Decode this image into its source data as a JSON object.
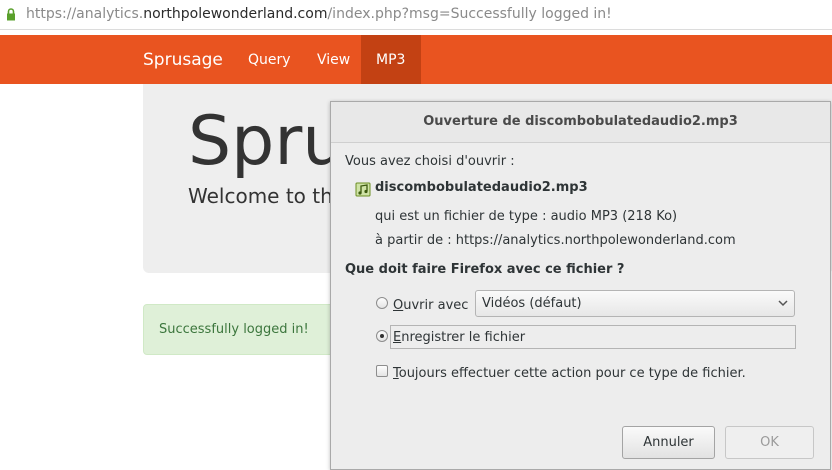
{
  "browser": {
    "url_prefix": "https://analytics.",
    "url_domain": "northpolewonderland.com",
    "url_suffix": "/index.php?msg=Successfully logged in!"
  },
  "navbar": {
    "brand": "Sprusage",
    "items": [
      {
        "label": "Query"
      },
      {
        "label": "View"
      },
      {
        "label": "MP3"
      }
    ],
    "active_item": "MP3",
    "color": "#e95420",
    "active_color": "#c34113"
  },
  "jumbotron": {
    "title": "Sprus",
    "subtitle": "Welcome to th"
  },
  "alert": {
    "message": "Successfully logged in!",
    "color": "#dff0d8"
  },
  "dialog": {
    "title": "Ouverture de discombobulatedaudio2.mp3",
    "chosen_label": "Vous avez choisi d'ouvrir :",
    "filename": "discombobulatedaudio2.mp3",
    "filetype_line": "qui est un fichier de type : audio MP3 (218 Ko)",
    "source_line": "à partir de : https://analytics.northpolewonderland.com",
    "question": "Que doit faire Firefox avec ce fichier ?",
    "open_with": {
      "label_first": "O",
      "label_rest": "uvrir avec",
      "selected": false,
      "app": "Vidéos (défaut)"
    },
    "save_file": {
      "label_first": "E",
      "label_rest": "nregistrer le fichier",
      "selected": true
    },
    "always": {
      "label_first": "T",
      "label_rest": "oujours effectuer cette action pour ce type de fichier.",
      "checked": false
    },
    "cancel_label": "Annuler",
    "ok_label": "OK"
  }
}
